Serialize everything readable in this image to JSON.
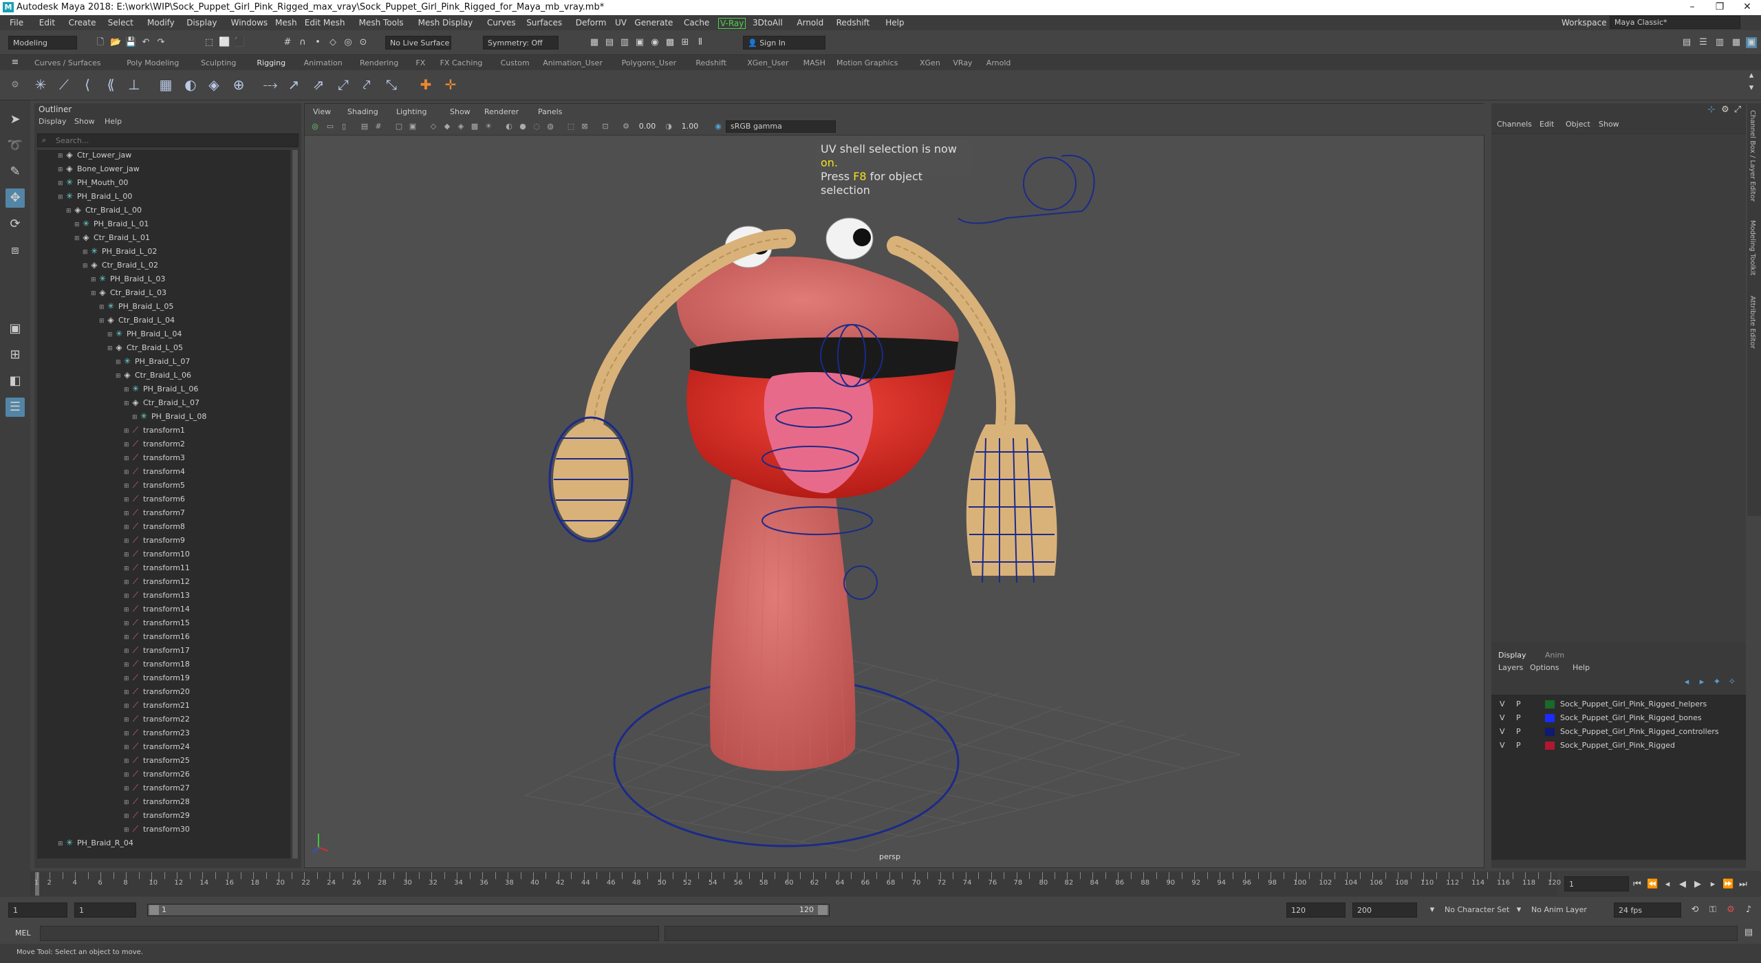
{
  "window": {
    "title": "Autodesk Maya 2018: E:\\work\\WIP\\Sock_Puppet_Girl_Pink_Rigged_max_vray\\Sock_Puppet_Girl_Pink_Rigged_for_Maya_mb_vray.mb*",
    "logo": "M"
  },
  "menubar": [
    "File",
    "Edit",
    "Create",
    "Select",
    "Modify",
    "Display",
    "Windows",
    "Mesh",
    "Edit Mesh",
    "Mesh Tools",
    "Mesh Display",
    "Curves",
    "Surfaces",
    "Deform",
    "UV",
    "Generate",
    "Cache",
    "V-Ray",
    "3DtoAll",
    "Arnold",
    "Redshift",
    "Help"
  ],
  "workspace": {
    "label": "Workspace :",
    "value": "Maya Classic*"
  },
  "statusline": {
    "mode": "Modeling",
    "live_surface": "No Live Surface",
    "symmetry": "Symmetry: Off",
    "sign_in": "Sign In"
  },
  "shelf_tabs": [
    "Curves / Surfaces",
    "Poly Modeling",
    "Sculpting",
    "Rigging",
    "Animation",
    "Rendering",
    "FX",
    "FX Caching",
    "Custom",
    "Animation_User",
    "Polygons_User",
    "Redshift",
    "XGen_User",
    "MASH",
    "Motion Graphics",
    "XGen",
    "VRay",
    "Arnold"
  ],
  "active_shelf": "Rigging",
  "outliner": {
    "title": "Outliner",
    "menu": [
      "Display",
      "Show",
      "Help"
    ],
    "search_placeholder": "Search...",
    "items": [
      {
        "label": "Ctr_Lower_jaw",
        "type": "grp",
        "depth": 1
      },
      {
        "label": "Bone_Lower_jaw",
        "type": "grp",
        "depth": 1
      },
      {
        "label": "PH_Mouth_00",
        "type": "joint",
        "depth": 1
      },
      {
        "label": "PH_Braid_L_00",
        "type": "joint",
        "depth": 1
      },
      {
        "label": "Ctr_Braid_L_00",
        "type": "grp",
        "depth": 2
      },
      {
        "label": "PH_Braid_L_01",
        "type": "joint",
        "depth": 3
      },
      {
        "label": "Ctr_Braid_L_01",
        "type": "grp",
        "depth": 3
      },
      {
        "label": "PH_Braid_L_02",
        "type": "joint",
        "depth": 4
      },
      {
        "label": "Ctr_Braid_L_02",
        "type": "grp",
        "depth": 4
      },
      {
        "label": "PH_Braid_L_03",
        "type": "joint",
        "depth": 5
      },
      {
        "label": "Ctr_Braid_L_03",
        "type": "grp",
        "depth": 5
      },
      {
        "label": "PH_Braid_L_05",
        "type": "joint",
        "depth": 6
      },
      {
        "label": "Ctr_Braid_L_04",
        "type": "grp",
        "depth": 6
      },
      {
        "label": "PH_Braid_L_04",
        "type": "joint",
        "depth": 7
      },
      {
        "label": "Ctr_Braid_L_05",
        "type": "grp",
        "depth": 7
      },
      {
        "label": "PH_Braid_L_07",
        "type": "joint",
        "depth": 8
      },
      {
        "label": "Ctr_Braid_L_06",
        "type": "grp",
        "depth": 8
      },
      {
        "label": "PH_Braid_L_06",
        "type": "joint",
        "depth": 9
      },
      {
        "label": "Ctr_Braid_L_07",
        "type": "grp",
        "depth": 9
      },
      {
        "label": "PH_Braid_L_08",
        "type": "joint",
        "depth": 10
      },
      {
        "label": "transform1",
        "type": "xf",
        "depth": 9
      },
      {
        "label": "transform2",
        "type": "xf",
        "depth": 9
      },
      {
        "label": "transform3",
        "type": "xf",
        "depth": 9
      },
      {
        "label": "transform4",
        "type": "xf",
        "depth": 9
      },
      {
        "label": "transform5",
        "type": "xf",
        "depth": 9
      },
      {
        "label": "transform6",
        "type": "xf",
        "depth": 9
      },
      {
        "label": "transform7",
        "type": "xf",
        "depth": 9
      },
      {
        "label": "transform8",
        "type": "xf",
        "depth": 9
      },
      {
        "label": "transform9",
        "type": "xf",
        "depth": 9
      },
      {
        "label": "transform10",
        "type": "xf",
        "depth": 9
      },
      {
        "label": "transform11",
        "type": "xf",
        "depth": 9
      },
      {
        "label": "transform12",
        "type": "xf",
        "depth": 9
      },
      {
        "label": "transform13",
        "type": "xf",
        "depth": 9
      },
      {
        "label": "transform14",
        "type": "xf",
        "depth": 9
      },
      {
        "label": "transform15",
        "type": "xf",
        "depth": 9
      },
      {
        "label": "transform16",
        "type": "xf",
        "depth": 9
      },
      {
        "label": "transform17",
        "type": "xf",
        "depth": 9
      },
      {
        "label": "transform18",
        "type": "xf",
        "depth": 9
      },
      {
        "label": "transform19",
        "type": "xf",
        "depth": 9
      },
      {
        "label": "transform20",
        "type": "xf",
        "depth": 9
      },
      {
        "label": "transform21",
        "type": "xf",
        "depth": 9
      },
      {
        "label": "transform22",
        "type": "xf",
        "depth": 9
      },
      {
        "label": "transform23",
        "type": "xf",
        "depth": 9
      },
      {
        "label": "transform24",
        "type": "xf",
        "depth": 9
      },
      {
        "label": "transform25",
        "type": "xf",
        "depth": 9
      },
      {
        "label": "transform26",
        "type": "xf",
        "depth": 9
      },
      {
        "label": "transform27",
        "type": "xf",
        "depth": 9
      },
      {
        "label": "transform28",
        "type": "xf",
        "depth": 9
      },
      {
        "label": "transform29",
        "type": "xf",
        "depth": 9
      },
      {
        "label": "transform30",
        "type": "xf",
        "depth": 9
      },
      {
        "label": "PH_Braid_R_04",
        "type": "joint",
        "depth": 1
      }
    ]
  },
  "viewport": {
    "menu": [
      "View",
      "Shading",
      "Lighting",
      "Show",
      "Renderer",
      "Panels"
    ],
    "exposure": "0.00",
    "gamma": "1.00",
    "color_space": "sRGB gamma",
    "hud_line1_a": "UV shell selection is now ",
    "hud_line1_b": "on.",
    "hud_line2_a": "Press ",
    "hud_line2_b": "F8",
    "hud_line2_c": " for object selection",
    "camera": "persp"
  },
  "channel_box": {
    "menu": [
      "Channels",
      "Edit",
      "Object",
      "Show"
    ],
    "layer_tabs": [
      "Display",
      "Anim"
    ],
    "layer_menu": [
      "Layers",
      "Options",
      "Help"
    ],
    "layers": [
      {
        "v": "V",
        "p": "P",
        "color": "#1a6a2a",
        "name": "Sock_Puppet_Girl_Pink_Rigged_helpers"
      },
      {
        "v": "V",
        "p": "P",
        "color": "#1a2cff",
        "name": "Sock_Puppet_Girl_Pink_Rigged_bones"
      },
      {
        "v": "V",
        "p": "P",
        "color": "#101a70",
        "name": "Sock_Puppet_Girl_Pink_Rigged_controllers"
      },
      {
        "v": "V",
        "p": "P",
        "color": "#b01830",
        "name": "Sock_Puppet_Girl_Pink_Rigged"
      }
    ]
  },
  "side_tabs": [
    "Channel Box / Layer Editor",
    "Modeling Toolkit",
    "Attribute Editor"
  ],
  "timeslider": {
    "labels": [
      "1",
      "2",
      "4",
      "6",
      "8",
      "10",
      "12",
      "14",
      "16",
      "18",
      "20",
      "22",
      "24",
      "26",
      "28",
      "30",
      "32",
      "34",
      "36",
      "38",
      "40",
      "42",
      "44",
      "46",
      "48",
      "50",
      "52",
      "54",
      "56",
      "58",
      "60",
      "62",
      "64",
      "66",
      "68",
      "70",
      "72",
      "74",
      "76",
      "78",
      "80",
      "82",
      "84",
      "86",
      "88",
      "90",
      "92",
      "94",
      "96",
      "98",
      "100",
      "102",
      "104",
      "106",
      "108",
      "110",
      "112",
      "114",
      "116",
      "118",
      "120"
    ],
    "current_frame": "1"
  },
  "range": {
    "start": "1",
    "playback_start": "1",
    "slider_start": "1",
    "slider_end": "120",
    "playback_end": "120",
    "end": "200",
    "character_set": "No Character Set",
    "anim_layer": "No Anim Layer",
    "fps": "24 fps"
  },
  "cmdline": {
    "label": "MEL"
  },
  "helpline": {
    "text": "Move Tool: Select an object to move."
  }
}
